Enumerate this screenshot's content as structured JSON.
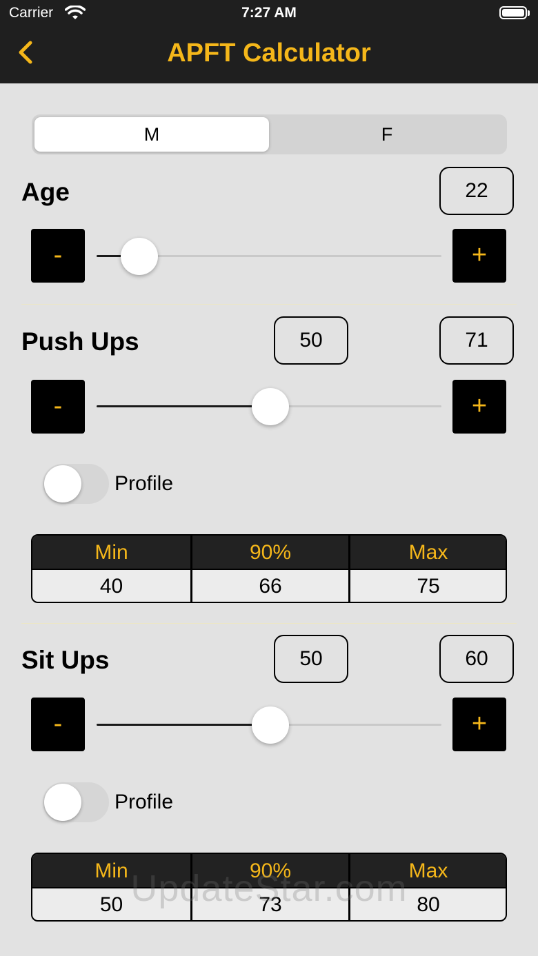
{
  "status": {
    "carrier": "Carrier",
    "time": "7:27 AM"
  },
  "nav": {
    "title": "APFT Calculator",
    "back_icon": "chevron-left-icon"
  },
  "gender": {
    "options": [
      "M",
      "F"
    ],
    "selected": "M"
  },
  "age": {
    "label": "Age",
    "value": "22",
    "minus": "-",
    "plus": "+",
    "slider_fraction": 0.12
  },
  "pushups": {
    "label": "Push Ups",
    "reps": "50",
    "score": "71",
    "minus": "-",
    "plus": "+",
    "slider_fraction": 0.5,
    "profile_label": "Profile",
    "profile_on": false,
    "table": {
      "headers": [
        "Min",
        "90%",
        "Max"
      ],
      "values": [
        "40",
        "66",
        "75"
      ]
    }
  },
  "situps": {
    "label": "Sit Ups",
    "reps": "50",
    "score": "60",
    "minus": "-",
    "plus": "+",
    "slider_fraction": 0.5,
    "profile_label": "Profile",
    "profile_on": false,
    "table": {
      "headers": [
        "Min",
        "90%",
        "Max"
      ],
      "values": [
        "50",
        "73",
        "80"
      ]
    }
  },
  "watermark": "UpdateStar.com",
  "colors": {
    "accent": "#f5b71a",
    "bar": "#1f1f1f",
    "background": "#e2e2e2"
  }
}
